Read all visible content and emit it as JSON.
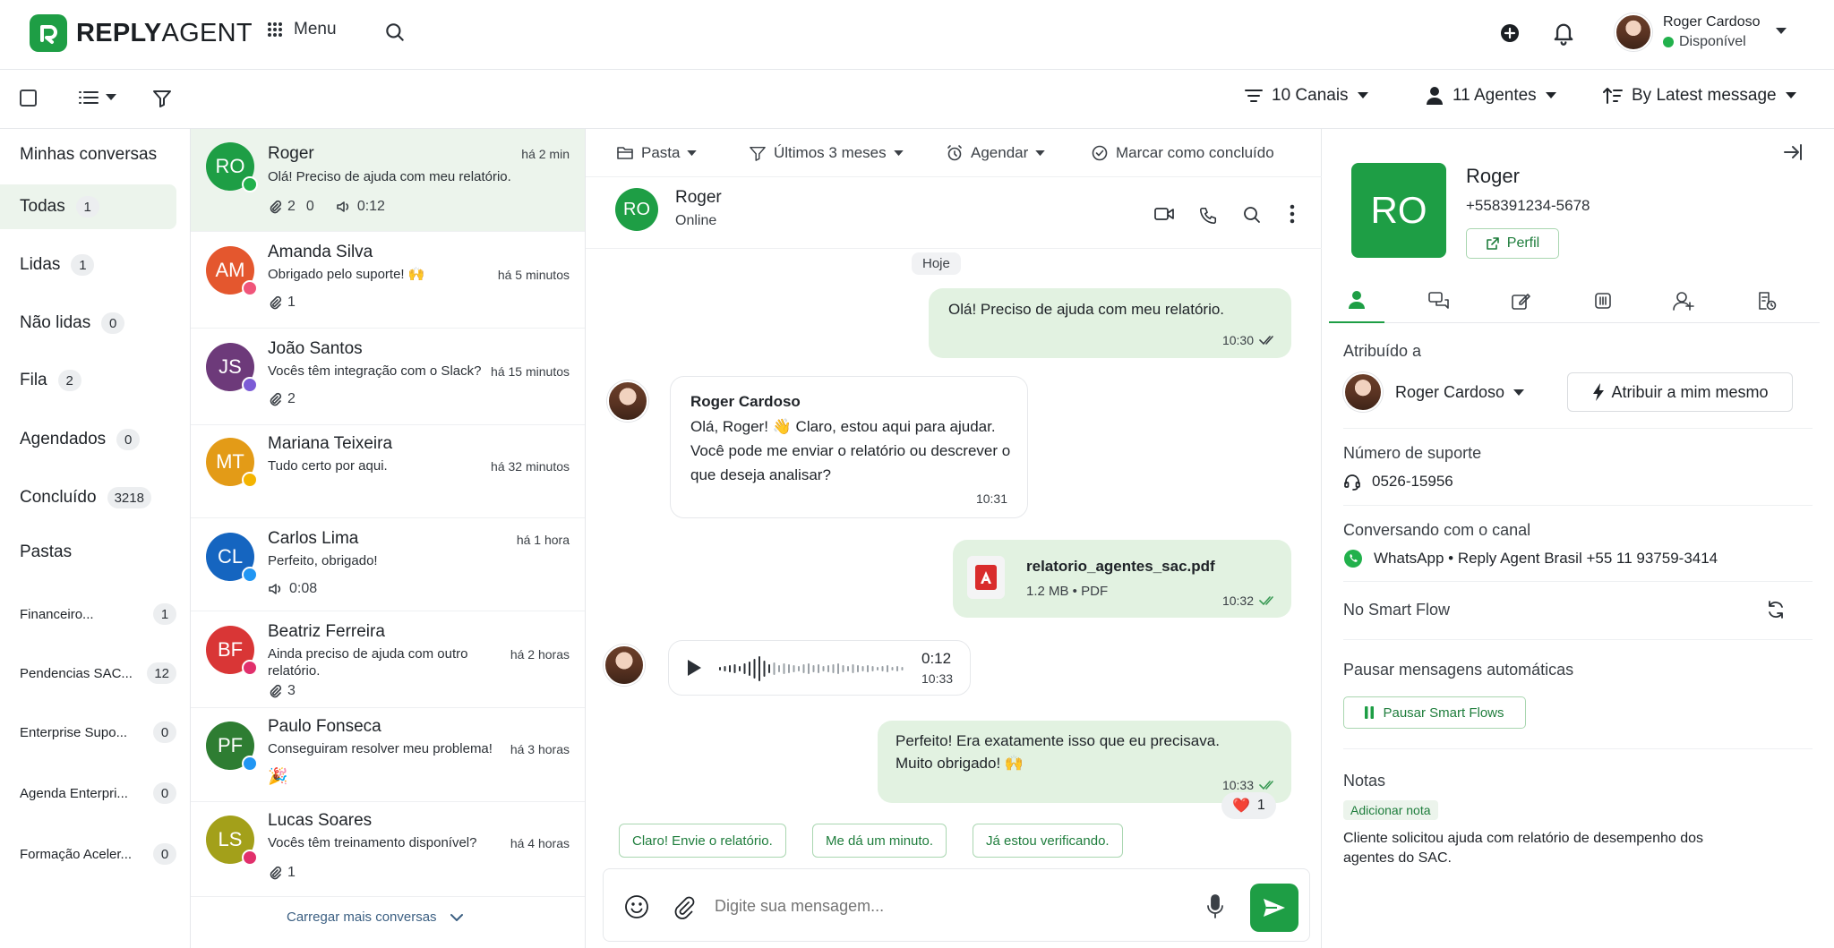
{
  "brand": {
    "name_bold": "REPLY",
    "name_light": "AGENT",
    "color": "#1e9e45"
  },
  "topbar": {
    "menu_label": "Menu",
    "user": {
      "name": "Roger Cardoso",
      "status": "Disponível"
    }
  },
  "toolbar": {
    "channels_label": "10 Canais",
    "agents_label": "11 Agentes",
    "sort_label": "By Latest message"
  },
  "sidebar": {
    "my_conversations": "Minhas conversas",
    "items": [
      {
        "label": "Todas",
        "count": "1"
      },
      {
        "label": "Lidas",
        "count": "1"
      },
      {
        "label": "Não lidas",
        "count": "0"
      },
      {
        "label": "Fila",
        "count": "2"
      },
      {
        "label": "Agendados",
        "count": "0"
      },
      {
        "label": "Concluído",
        "count": "3218"
      }
    ],
    "folders_title": "Pastas",
    "folders": [
      {
        "label": "Financeiro...",
        "count": "1"
      },
      {
        "label": "Pendencias SAC...",
        "count": "12"
      },
      {
        "label": "Enterprise Supo...",
        "count": "0"
      },
      {
        "label": "Agenda Enterpri...",
        "count": "0"
      },
      {
        "label": "Formação Aceler...",
        "count": "0"
      }
    ]
  },
  "conversations": [
    {
      "initials": "RO",
      "name": "Roger",
      "time": "há 2 min",
      "preview": "Olá! Preciso de ajuda com meu relatório.",
      "attachments": "2",
      "count2": "0",
      "audio": "0:12",
      "color": "#1e9e45",
      "channel_color": "#22b14c"
    },
    {
      "initials": "AM",
      "name": "Amanda Silva",
      "time": "há 5 minutos",
      "preview": "Obrigado pelo suporte! 🙌",
      "attachments": "1",
      "color": "#e4572e",
      "channel_color": "#f0557a"
    },
    {
      "initials": "JS",
      "name": "João Santos",
      "time": "há 15 minutos",
      "preview": "Vocês têm integração com o Slack?",
      "attachments": "2",
      "color": "#6d3a7a",
      "channel_color": "#7c5cd6"
    },
    {
      "initials": "MT",
      "name": "Mariana Teixeira",
      "time": "há 32 minutos",
      "preview": "Tudo certo por aqui.",
      "color": "#e39b17",
      "channel_color": "#f4b400"
    },
    {
      "initials": "CL",
      "name": "Carlos Lima",
      "time": "há 1 hora",
      "preview": "Perfeito, obrigado!",
      "audio": "0:08",
      "color": "#1565c0",
      "channel_color": "#2196f3"
    },
    {
      "initials": "BF",
      "name": "Beatriz Ferreira",
      "time": "há 2 horas",
      "preview": "Ainda preciso de ajuda com outro relatório.",
      "attachments": "3",
      "color": "#d93636",
      "channel_color": "#e1306c"
    },
    {
      "initials": "PF",
      "name": "Paulo Fonseca",
      "time": "há 3 horas",
      "preview": "Conseguiram resolver meu problema!",
      "emoji": "🎉",
      "color": "#2e7d32",
      "channel_color": "#2196f3"
    },
    {
      "initials": "LS",
      "name": "Lucas Soares",
      "time": "há 4 horas",
      "preview": "Vocês têm treinamento disponível?",
      "attachments": "1",
      "color": "#a3a01a",
      "channel_color": "#e1306c"
    }
  ],
  "load_more": "Carregar mais conversas",
  "chat": {
    "tools": {
      "folder": "Pasta",
      "period": "Últimos 3 meses",
      "schedule": "Agendar",
      "done": "Marcar como concluído"
    },
    "contact": {
      "initials": "RO",
      "name": "Roger",
      "status": "Online"
    },
    "day": "Hoje",
    "messages": [
      {
        "text": "Olá! Preciso de ajuda com meu relatório.",
        "time": "10:30"
      },
      {
        "sender": "Roger Cardoso",
        "text": "Olá, Roger! 👋 Claro, estou aqui para ajudar. Você pode me enviar o relatório ou descrever o que deseja analisar?",
        "time": "10:31"
      },
      {
        "file_name": "relatorio_agentes_sac.pdf",
        "file_meta": "1.2 MB • PDF",
        "time": "10:32"
      },
      {
        "duration": "0:12",
        "time": "10:33"
      },
      {
        "text": "Perfeito! Era exatamente isso que eu precisava. Muito obrigado! 🙌",
        "time": "10:33",
        "reaction": "❤️",
        "reaction_count": "1"
      }
    ],
    "quick_replies": [
      "Claro! Envie o relatório.",
      "Me dá um minuto.",
      "Já estou verificando."
    ],
    "composer_placeholder": "Digite sua mensagem..."
  },
  "panel": {
    "initials": "RO",
    "name": "Roger",
    "phone": "+558391234-5678",
    "profile_label": "Perfil",
    "assigned_label": "Atribuído a",
    "assigned_name": "Roger Cardoso",
    "assign_me": "Atribuir a mim mesmo",
    "support_label": "Número de suporte",
    "support_number": "0526-15956",
    "channel_label": "Conversando com o canal",
    "channel_value": "WhatsApp • Reply Agent Brasil +55 11 93759-3414",
    "smart_flow": "No Smart Flow",
    "pause_label": "Pausar mensagens automáticas",
    "pause_button": "Pausar Smart Flows",
    "notes_label": "Notas",
    "add_note": "Adicionar nota",
    "note_text": "Cliente solicitou ajuda com relatório de desempenho dos agentes do SAC."
  }
}
